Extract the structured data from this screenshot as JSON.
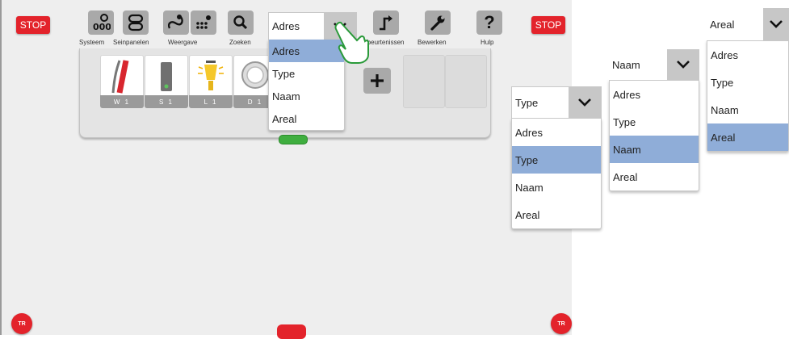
{
  "stop_label": "STOP",
  "toolbar": {
    "labels": [
      "Systeem",
      "Seinpanelen",
      "Weergave",
      "Zoeken",
      "Gebeurtenissen",
      "Bewerken",
      "Hulp"
    ]
  },
  "panel": {
    "tiles": [
      {
        "label": "W 1",
        "icon": "turnout-icon"
      },
      {
        "label": "S 1",
        "icon": "signal-icon"
      },
      {
        "label": "L 1",
        "icon": "lamp-icon"
      },
      {
        "label": "D 1",
        "icon": "decoupler-icon"
      }
    ],
    "add_icon": "plus-icon"
  },
  "corner_button_label": "TR",
  "dropdowns": [
    {
      "name": "main",
      "value": "Adres",
      "options": [
        "Adres",
        "Type",
        "Naam",
        "Areal"
      ],
      "selected": "Adres"
    },
    {
      "name": "type",
      "value": "Type",
      "options": [
        "Adres",
        "Type",
        "Naam",
        "Areal"
      ],
      "selected": "Type"
    },
    {
      "name": "naam",
      "value": "Naam",
      "options": [
        "Adres",
        "Type",
        "Naam",
        "Areal"
      ],
      "selected": "Naam"
    },
    {
      "name": "areal",
      "value": "Areal",
      "options": [
        "Adres",
        "Type",
        "Naam",
        "Areal"
      ],
      "selected": "Areal"
    }
  ],
  "colors": {
    "stop": "#e3232b",
    "selection": "#8fadd8",
    "handle": "#3fae3f"
  }
}
